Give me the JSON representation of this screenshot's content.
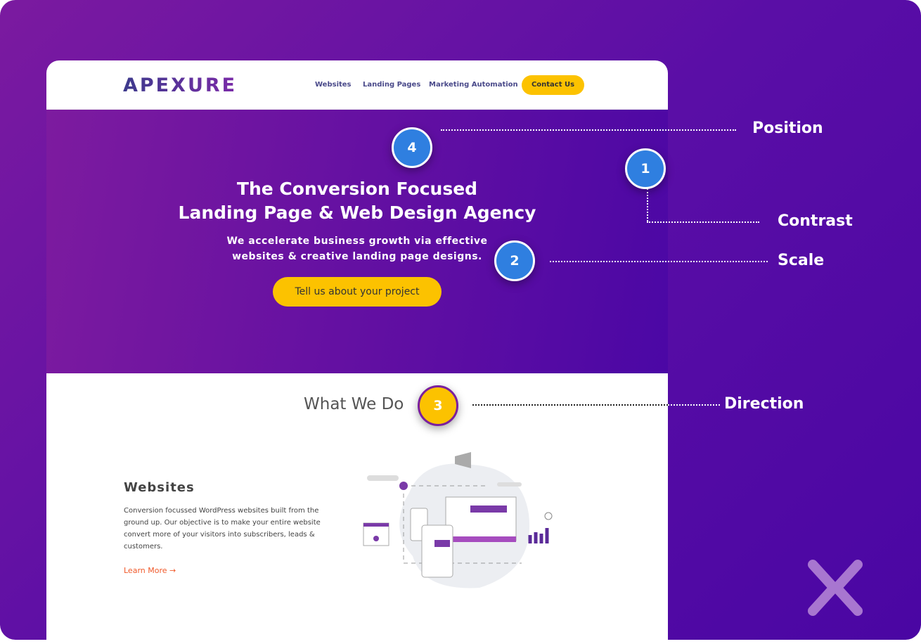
{
  "site": {
    "logo": "APEXURE",
    "nav": [
      "Websites",
      "Landing Pages",
      "Marketing Automation"
    ],
    "contact": "Contact Us"
  },
  "hero": {
    "title_line1": "The Conversion Focused",
    "title_line2": "Landing Page & Web Design Agency",
    "sub_line1": "We accelerate business growth via effective",
    "sub_line2": "websites & creative landing page designs.",
    "cta": "Tell us about your project"
  },
  "section": {
    "title": "What We Do",
    "item_title": "Websites",
    "item_desc": "Conversion focussed WordPress websites built from the ground up. Our objective is to make your entire website convert more of your visitors into subscribers, leads & customers.",
    "learn_more": "Learn More →"
  },
  "annotations": [
    {
      "num": "4",
      "label": "Position"
    },
    {
      "num": "1",
      "label": "Contrast"
    },
    {
      "num": "2",
      "label": "Scale"
    },
    {
      "num": "3",
      "label": "Direction"
    }
  ],
  "colors": {
    "accent": "#fcc200",
    "marker": "#2f7fe0",
    "purple": "#6410a2"
  }
}
